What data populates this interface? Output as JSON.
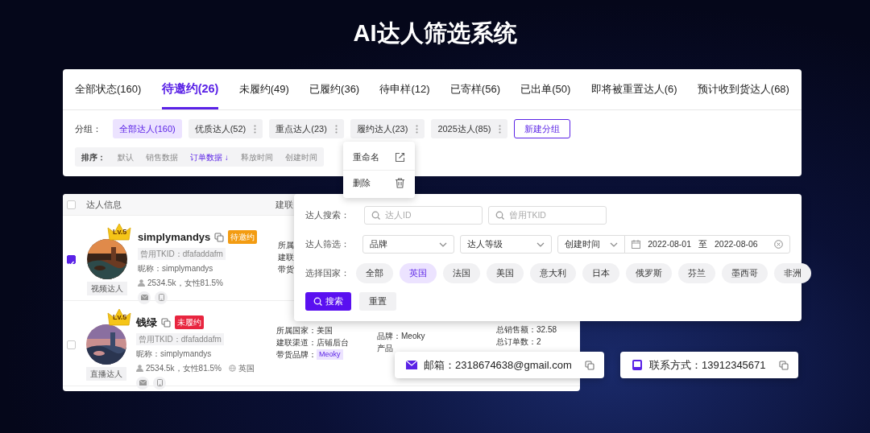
{
  "title": "AI达人筛选系统",
  "status_tabs": [
    {
      "label": "全部状态(160)",
      "selected": false
    },
    {
      "label": "待邀约(26)",
      "selected": true
    },
    {
      "label": "未履约(49)",
      "selected": false
    },
    {
      "label": "已履约(36)",
      "selected": false
    },
    {
      "label": "待申样(12)",
      "selected": false
    },
    {
      "label": "已寄样(56)",
      "selected": false
    },
    {
      "label": "已出单(50)",
      "selected": false
    },
    {
      "label": "即将被重置达人(6)",
      "selected": false
    },
    {
      "label": "预计收到货达人(68)",
      "selected": false
    }
  ],
  "groups": {
    "label": "分组：",
    "items": [
      {
        "label": "全部达人(160)",
        "selected": true,
        "has_menu": false
      },
      {
        "label": "优质达人(52)",
        "selected": false,
        "has_menu": true
      },
      {
        "label": "重点达人(23)",
        "selected": false,
        "has_menu": true
      },
      {
        "label": "履约达人(23)",
        "selected": false,
        "has_menu": true
      },
      {
        "label": "2025达人(85)",
        "selected": false,
        "has_menu": true
      }
    ],
    "new_button": "新建分组"
  },
  "sort": {
    "label": "排序：",
    "options": [
      {
        "label": "默认",
        "selected": false
      },
      {
        "label": "销售数据",
        "selected": false
      },
      {
        "label": "订单数据 ↓",
        "selected": true
      },
      {
        "label": "释放时间",
        "selected": false
      },
      {
        "label": "创建时间",
        "selected": false
      }
    ]
  },
  "group_menu": [
    {
      "label": "重命名",
      "kind": "edit"
    },
    {
      "label": "删除",
      "kind": "delete"
    }
  ],
  "table": {
    "select_all_checked": false,
    "columns": [
      "达人信息",
      "建联"
    ],
    "rows": [
      {
        "checked": true,
        "name": "simplymandys",
        "status": "待邀约",
        "color": "#f39c12",
        "level": "Lv.5",
        "type": "视频达人",
        "tkid": "曾用TKID：dfafaddafm",
        "nickname": "昵称：simplymandys",
        "fans": "2534.5k，女性81.5%",
        "details": [
          [
            {
              "text": "所属"
            },
            {
              "text": "建联"
            },
            {
              "text": "带货"
            }
          ]
        ]
      },
      {
        "checked": false,
        "name": "钱绿",
        "status": "未履约",
        "color": "#e8253f",
        "level": "Lv.5",
        "type": "直播达人",
        "tkid": "曾用TKID：dfafaddafm",
        "nickname": "昵称：simplymandys",
        "fans": "2534.5k，女性81.5%",
        "country": "英国",
        "details": [
          [
            {
              "text": "所属国家：美国"
            },
            {
              "text": "建联渠道：店铺后台"
            },
            {
              "text": "带货品牌：",
              "tag": "Meoky"
            }
          ],
          [
            {
              "text": "品牌：Meoky"
            },
            {
              "text": "产品"
            }
          ],
          [
            {
              "text": "总销售额：32.58"
            },
            {
              "text": "总订单数：2"
            }
          ]
        ]
      }
    ]
  },
  "filter": {
    "search": {
      "label": "达人搜索：",
      "fields": [
        {
          "placeholder": "达人ID"
        },
        {
          "placeholder": "曾用TKID"
        }
      ]
    },
    "selects": {
      "label": "达人筛选：",
      "options": [
        "品牌",
        "达人等级",
        "创建时间"
      ],
      "date_from": "2022-08-01",
      "date_sep": "至",
      "date_to": "2022-08-06"
    },
    "countries": {
      "label": "选择国家：",
      "items": [
        {
          "label": "全部",
          "selected": false
        },
        {
          "label": "英国",
          "selected": true
        },
        {
          "label": "法国",
          "selected": false
        },
        {
          "label": "美国",
          "selected": false
        },
        {
          "label": "意大利",
          "selected": false
        },
        {
          "label": "日本",
          "selected": false
        },
        {
          "label": "俄罗斯",
          "selected": false
        },
        {
          "label": "芬兰",
          "selected": false
        },
        {
          "label": "墨西哥",
          "selected": false
        },
        {
          "label": "非洲",
          "selected": false
        }
      ]
    },
    "buttons": [
      {
        "label": "搜索",
        "kind": "primary"
      },
      {
        "label": "重置",
        "kind": "secondary"
      }
    ]
  },
  "contacts": [
    {
      "kind": "email",
      "text": "邮箱：2318674638@gmail.com"
    },
    {
      "kind": "phone",
      "text": "联系方式：13912345671"
    }
  ]
}
